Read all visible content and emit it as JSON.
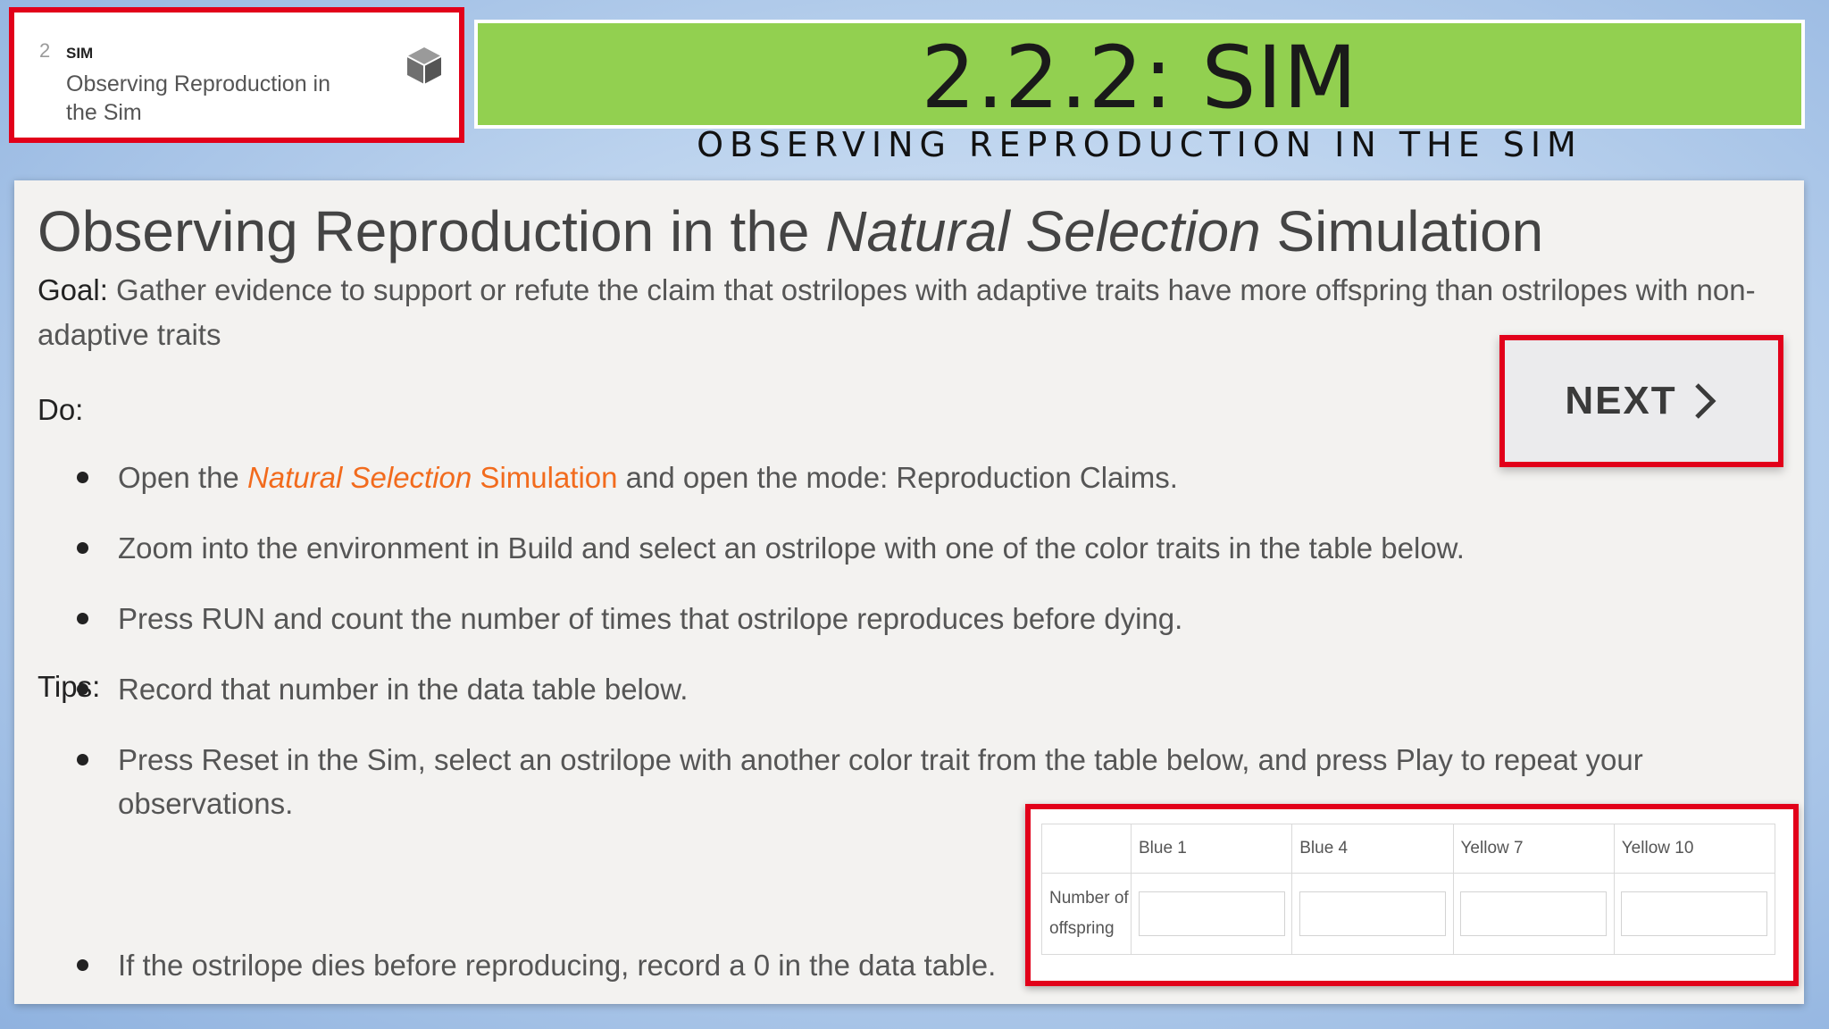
{
  "lesson_card": {
    "number": "2",
    "type": "SIM",
    "title": "Observing Reproduction in the Sim",
    "icon": "cube-icon"
  },
  "header": {
    "title": "2.2.2: SIM",
    "subtitle": "OBSERVING REPRODUCTION IN THE SIM",
    "banner_color": "#92d050"
  },
  "content": {
    "heading_part1": "Observing Reproduction in the ",
    "heading_italic": "Natural Selection",
    "heading_part2": " Simulation",
    "goal_label": "Goal:",
    "goal_text": " Gather evidence to support or refute the claim that ostrilopes with adaptive traits have more offspring than ostrilopes with non-adaptive traits",
    "do_label": "Do:",
    "bullet1_prefix": "Open the ",
    "bullet1_link_italic": "Natural Selection",
    "bullet1_link_rest": " Simulation",
    "bullet1_suffix": " and open the mode: Reproduction Claims.",
    "bullet2": "Zoom into the environment in Build and select an ostrilope with one of the color traits in the table below.",
    "bullet3": "Press RUN and count the number of times that ostrilope reproduces before dying.",
    "bullet4": "Record that number in the data table below.",
    "bullet5": "Press Reset in the Sim, select an ostrilope with another color trait from the table below, and press Play to repeat your observations.",
    "tips_label": "Tips:",
    "tip1": "If the ostrilope dies before reproducing, record a 0 in the data table.",
    "link_color": "#f26b1d"
  },
  "next_button": {
    "label": "NEXT"
  },
  "data_table": {
    "columns": [
      "Blue 1",
      "Blue 4",
      "Yellow 7",
      "Yellow 10"
    ],
    "row_label": "Number of offspring",
    "values": [
      "",
      "",
      "",
      ""
    ]
  },
  "highlight_color": "#e2001a"
}
